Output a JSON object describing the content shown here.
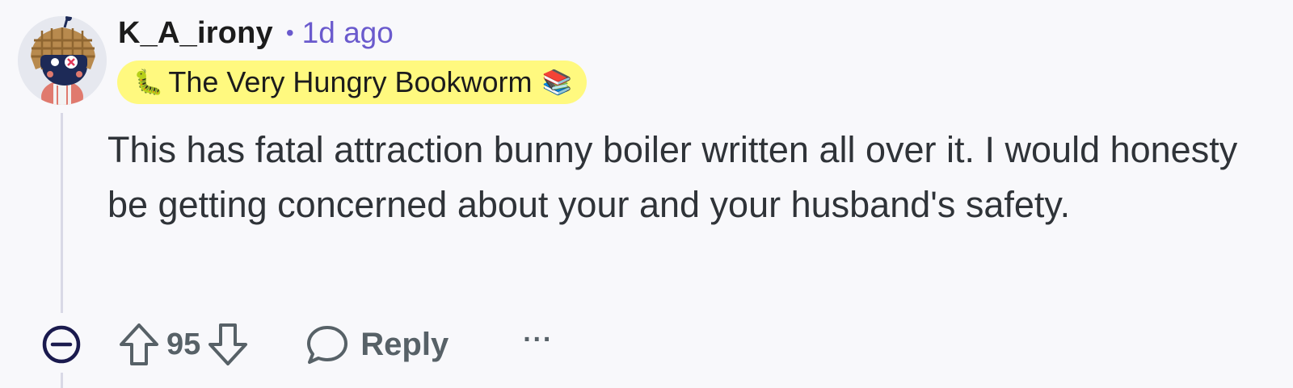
{
  "comment": {
    "author": "K_A_irony",
    "separator": "•",
    "timestamp": "1d ago",
    "flair": {
      "emoji_start": "🐛",
      "text": "The Very Hungry Bookworm",
      "emoji_end": "📚",
      "background_color": "#fff97f"
    },
    "body": "This has fatal attraction bunny boiler written all over it. I would honesty be getting concerned about your and your husband's safety.",
    "score": "95",
    "actions": {
      "collapse_icon": "minus-circle-icon",
      "upvote_icon": "arrow-up-icon",
      "downvote_icon": "arrow-down-icon",
      "reply_icon": "speech-bubble-icon",
      "reply_label": "Reply",
      "more_label": "···"
    }
  },
  "colors": {
    "username": "#1c1c1c",
    "timestamp": "#6a5acd",
    "body_text": "#2f3338",
    "action_text": "#576167",
    "collapse_icon": "#1a1a4e",
    "thread_line": "#d9d9e6",
    "background": "#f8f8fb"
  }
}
